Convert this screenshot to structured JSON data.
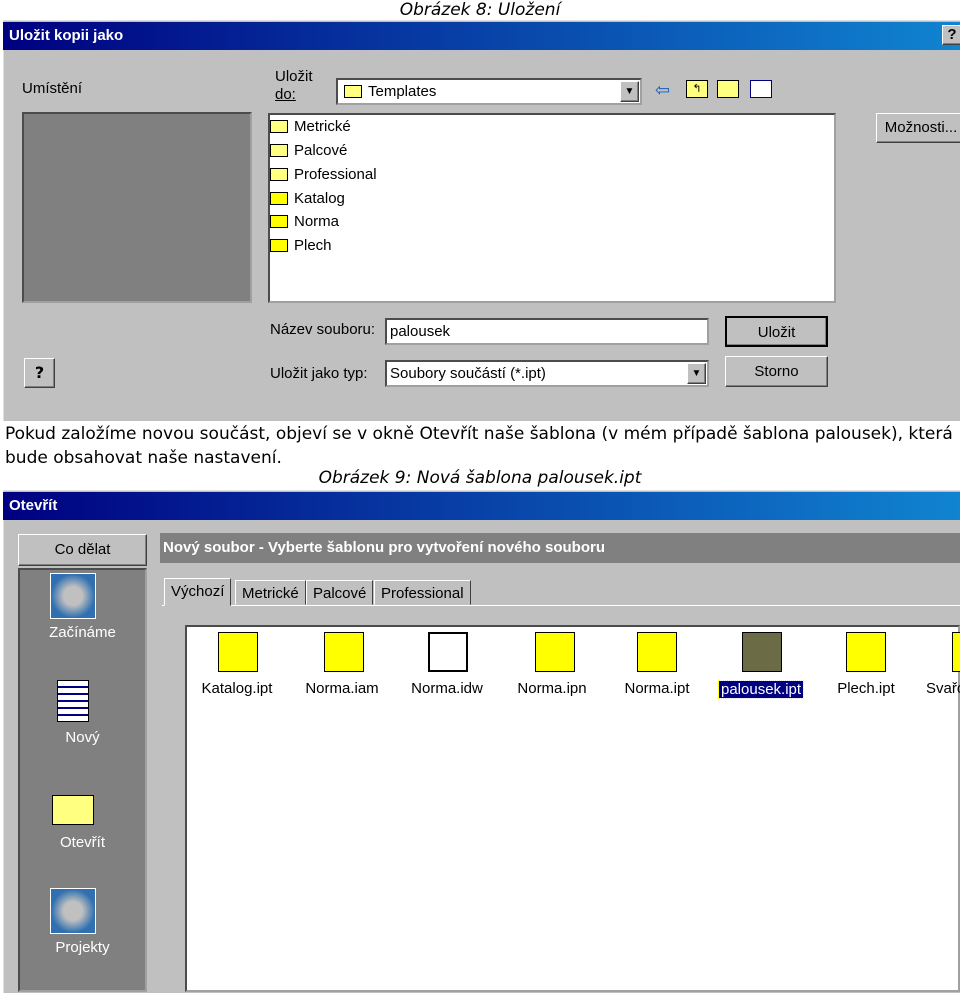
{
  "caption1": "Obrázek 8: Uložení",
  "save_dialog": {
    "title": "Uložit kopii jako",
    "help": "?",
    "location_label": "Umístění",
    "save_in_label_1": "Uložit",
    "save_in_label_2": "do:",
    "save_in_value": "Templates",
    "folders": [
      "Metrické",
      "Palcové",
      "Professional",
      "Katalog",
      "Norma",
      "Plech"
    ],
    "options_button": "Možnosti...",
    "filename_label": "Název souboru:",
    "filename_value": "palousek",
    "save_button": "Uložit",
    "type_label": "Uložit jako typ:",
    "type_value": "Soubory součástí (*.ipt)",
    "cancel_button": "Storno"
  },
  "paragraph": "Pokud založíme novou součást, objeví se v okně Otevřít naše šablona (v mém případě šablona palousek), která bude obsahovat naše nastavení.",
  "caption2": "Obrázek 9: Nová šablona palousek.ipt",
  "open_dialog": {
    "title": "Otevřít",
    "what_to_do": "Co dělat",
    "sidebar": [
      "Začínáme",
      "Nový",
      "Otevřít",
      "Projekty"
    ],
    "header": "Nový soubor - Vyberte šablonu pro vytvoření nového souboru",
    "tabs": [
      "Výchozí",
      "Metrické",
      "Palcové",
      "Professional"
    ],
    "files": [
      "Katalog.ipt",
      "Norma.iam",
      "Norma.idw",
      "Norma.ipn",
      "Norma.ipt",
      "palousek.ipt",
      "Plech.ipt",
      "Svařo"
    ],
    "selected_file": "palousek.ipt"
  }
}
